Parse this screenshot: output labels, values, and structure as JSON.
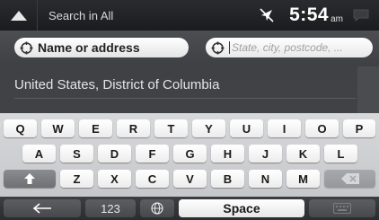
{
  "topbar": {
    "title": "Search in All",
    "time": "5:54",
    "ampm": "am",
    "icons": [
      "up-arrow-icon",
      "gps-off-icon",
      "message-icon"
    ]
  },
  "search": {
    "field_active_label": "Name or address",
    "field_inactive_placeholder": "State, city, postcode, ...",
    "location": "United States, District of Columbia"
  },
  "keyboard": {
    "row1": [
      "Q",
      "W",
      "E",
      "R",
      "T",
      "Y",
      "U",
      "I",
      "O",
      "P"
    ],
    "row2": [
      "A",
      "S",
      "D",
      "F",
      "G",
      "H",
      "J",
      "K",
      "L"
    ],
    "row3": [
      "Z",
      "X",
      "C",
      "V",
      "B",
      "N",
      "M"
    ],
    "numbers_label": "123",
    "space_label": "Space"
  },
  "colors": {
    "accent_text": "#e4e4e4",
    "topbar": "#1e1f22",
    "keyboard_bg": "#cfd0d2"
  }
}
